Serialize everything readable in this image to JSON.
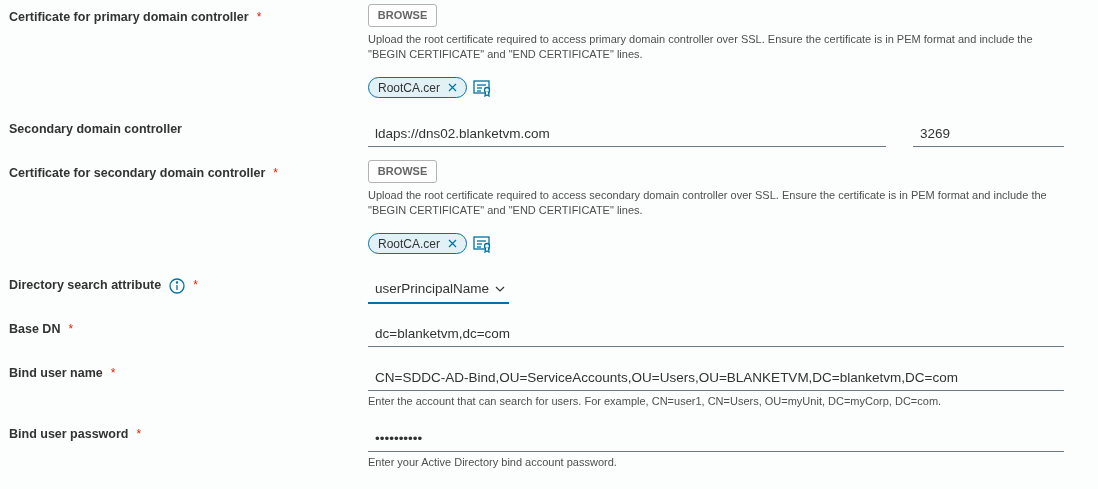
{
  "fields": [
    {
      "kind": "certificate",
      "label": "Certificate for primary domain controller",
      "required_mark": "*",
      "button": "BROWSE",
      "help": "Upload the root certificate required to access primary domain controller over SSL. Ensure the certificate is in PEM format and include the \"BEGIN CERTIFICATE\" and \"END CERTIFICATE\" lines.",
      "file": "RootCA.cer"
    },
    {
      "kind": "host_port",
      "label": "Secondary domain controller",
      "value": "ldaps://dns02.blanketvm.com",
      "port": "3269"
    },
    {
      "kind": "certificate",
      "label": "Certificate for secondary domain controller",
      "required_mark": "*",
      "button": "BROWSE",
      "help": "Upload the root certificate required to access secondary domain controller over SSL. Ensure the certificate is in PEM format and include the \"BEGIN CERTIFICATE\" and \"END CERTIFICATE\" lines.",
      "file": "RootCA.cer"
    },
    {
      "kind": "select",
      "label": "Directory search attribute",
      "required_mark": "*",
      "info": true,
      "value": "userPrincipalName"
    },
    {
      "kind": "text",
      "label": "Base DN",
      "required_mark": "*",
      "value": "dc=blanketvm,dc=com"
    },
    {
      "kind": "text",
      "label": "Bind user name",
      "required_mark": "*",
      "value": "CN=SDDC-AD-Bind,OU=ServiceAccounts,OU=Users,OU=BLANKETVM,DC=blanketvm,DC=com",
      "help": "Enter the account that can search for users. For example, CN=user1, CN=Users, OU=myUnit, DC=myCorp, DC=com."
    },
    {
      "kind": "text",
      "label": "Bind user password",
      "required_mark": "*",
      "value": "••••••••••",
      "help": "Enter your Active Directory bind account password."
    }
  ]
}
